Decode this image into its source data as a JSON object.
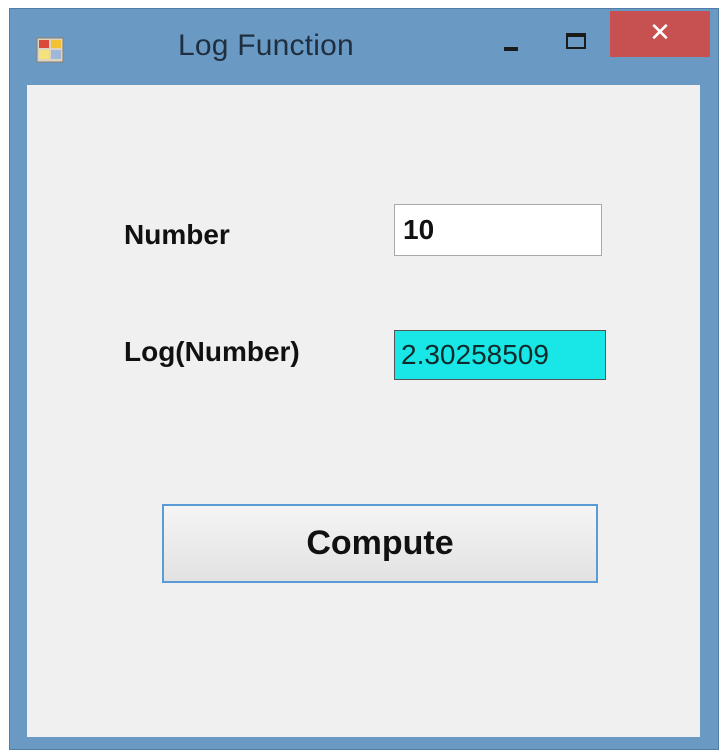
{
  "window": {
    "title": "Log Function",
    "close_glyph": "✕",
    "icons": {
      "app": "app-form-icon",
      "minimize": "minimize-icon",
      "maximize": "maximize-icon",
      "close": "close-icon"
    },
    "colors": {
      "frame": "#6a9ac4",
      "close_button": "#c75050",
      "client_background": "#f0f0f0"
    }
  },
  "form": {
    "number_label": "Number",
    "number_value": "10",
    "log_label": "Log(Number)",
    "log_value": "2.30258509",
    "compute_label": "Compute",
    "colors": {
      "output_background": "#19e6e6",
      "button_border": "#5b9bd5"
    }
  }
}
